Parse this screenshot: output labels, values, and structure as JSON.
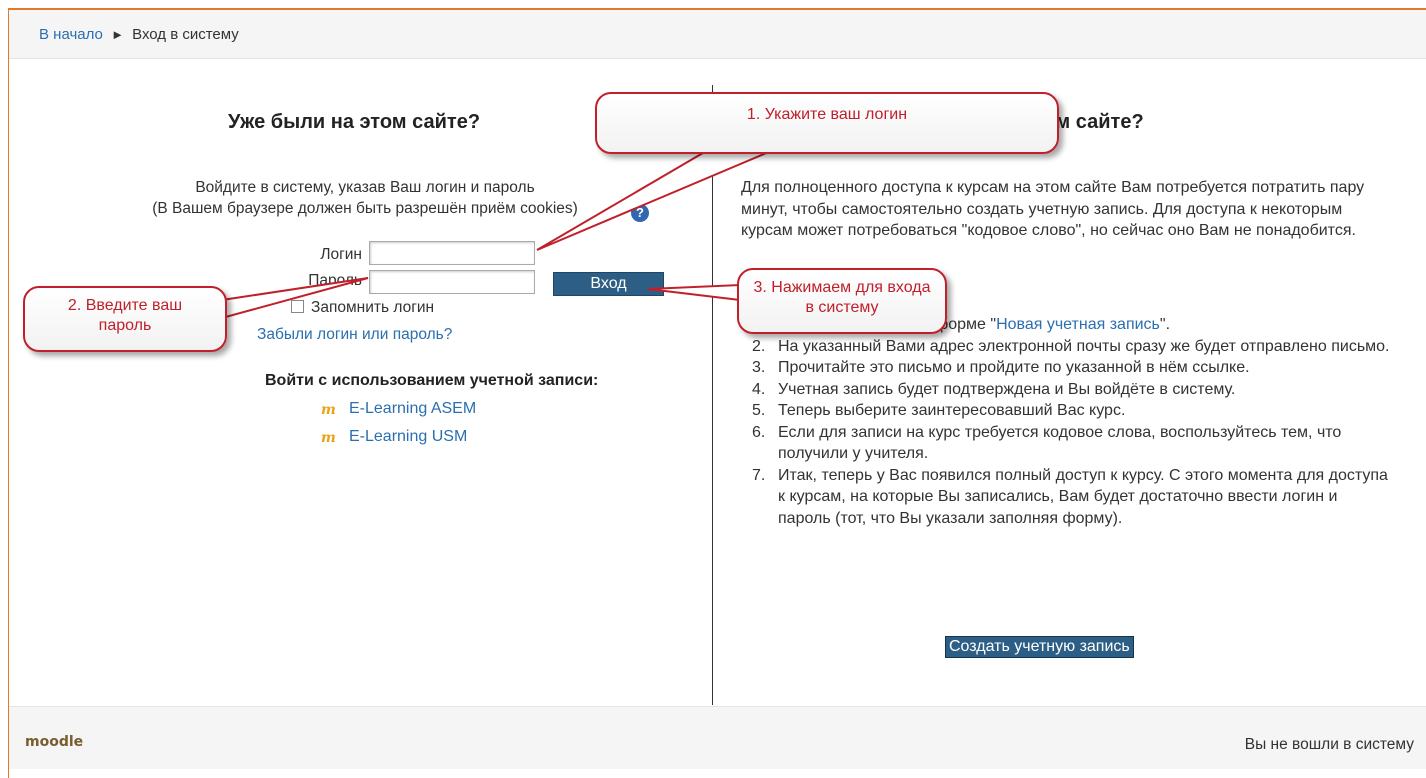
{
  "breadcrumb": {
    "home": "В начало",
    "separator": "►",
    "current": "Вход в систему"
  },
  "login": {
    "heading": "Уже были на этом сайте?",
    "intro_line1": "Войдите в систему, указав Ваш логин и пароль",
    "intro_line2": "(В Вашем браузере должен быть разрешён приём cookies)",
    "username_label": "Логин",
    "username_value": "",
    "password_label": "Пароль",
    "password_value": "",
    "login_button": "Вход",
    "remember_label": "Запомнить логин",
    "forgot_link": "Забыли логин или пароль?",
    "oauth_title": "Войти с использованием учетной записи:",
    "oauth_providers": [
      "E-Learning ASEM",
      "E-Learning USM"
    ]
  },
  "signup": {
    "heading": "Впервые на нашем сайте?",
    "text": "Для полноценного доступа к курсам на этом сайте Вам потребуется потратить пару минут, чтобы самостоятельно создать учетную запись. Для доступа к некоторым курсам может потребоваться \"кодовое слово\", но сейчас оно Вам не понадобится.",
    "step1_prefix": "Заполните данные в форме \"",
    "step1_link": "Новая учетная запись",
    "step1_suffix": "\".",
    "steps": [
      "На указанный Вами адрес электронной почты сразу же будет отправлено письмо.",
      "Прочитайте это письмо и пройдите по указанной в нём ссылке.",
      "Учетная запись будет подтверждена и Вы войдёте в систему.",
      "Теперь выберите заинтересовавший Вас курс.",
      "Если для записи на курс требуется кодовое слова, воспользуйтесь тем, что получили у учителя.",
      "Итак, теперь у Вас появился полный доступ к курсу. С этого момента для доступа к курсам, на которые Вы записались, Вам будет достаточно ввести логин и пароль (тот, что Вы указали заполняя форму)."
    ],
    "create_button": "Создать учетную запись"
  },
  "callouts": {
    "c1": "1. Укажите ваш логин",
    "c2": "2. Введите ваш пароль",
    "c3": "3. Нажимаем для входа в систему"
  },
  "footer": {
    "logo": "moodle",
    "status": "Вы не вошли в систему"
  },
  "colors": {
    "accent": "#e07a2a",
    "link": "#2a6fb0",
    "button": "#2d5f86",
    "callout": "#c0202a"
  }
}
